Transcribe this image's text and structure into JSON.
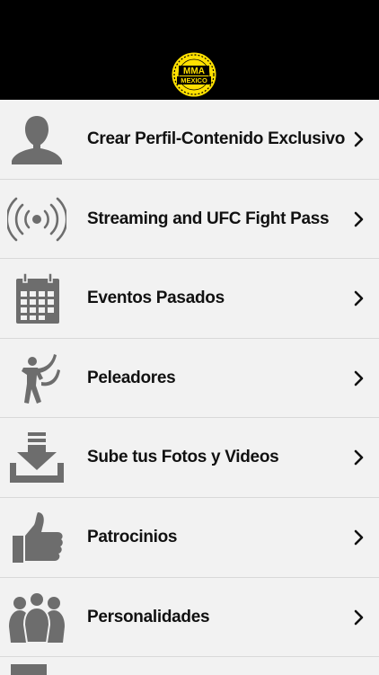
{
  "header": {
    "logo_text_top": "MMA",
    "logo_text_bottom": "MEXICO",
    "logo_color": "#ffe000",
    "background": "#000000"
  },
  "menu": {
    "items": [
      {
        "label": "Crear Perfil-Contenido Exclusivo",
        "icon": "user-profile-icon"
      },
      {
        "label": "Streaming and UFC Fight Pass",
        "icon": "broadcast-icon"
      },
      {
        "label": "Eventos Pasados",
        "icon": "calendar-icon"
      },
      {
        "label": "Peleadores",
        "icon": "fighter-icon"
      },
      {
        "label": "Sube tus Fotos y Videos",
        "icon": "download-tray-icon"
      },
      {
        "label": "Patrocinios",
        "icon": "thumbs-up-icon"
      },
      {
        "label": "Personalidades",
        "icon": "people-group-icon"
      }
    ],
    "icon_color": "#6d6d6d",
    "chevron_color": "#111111"
  }
}
